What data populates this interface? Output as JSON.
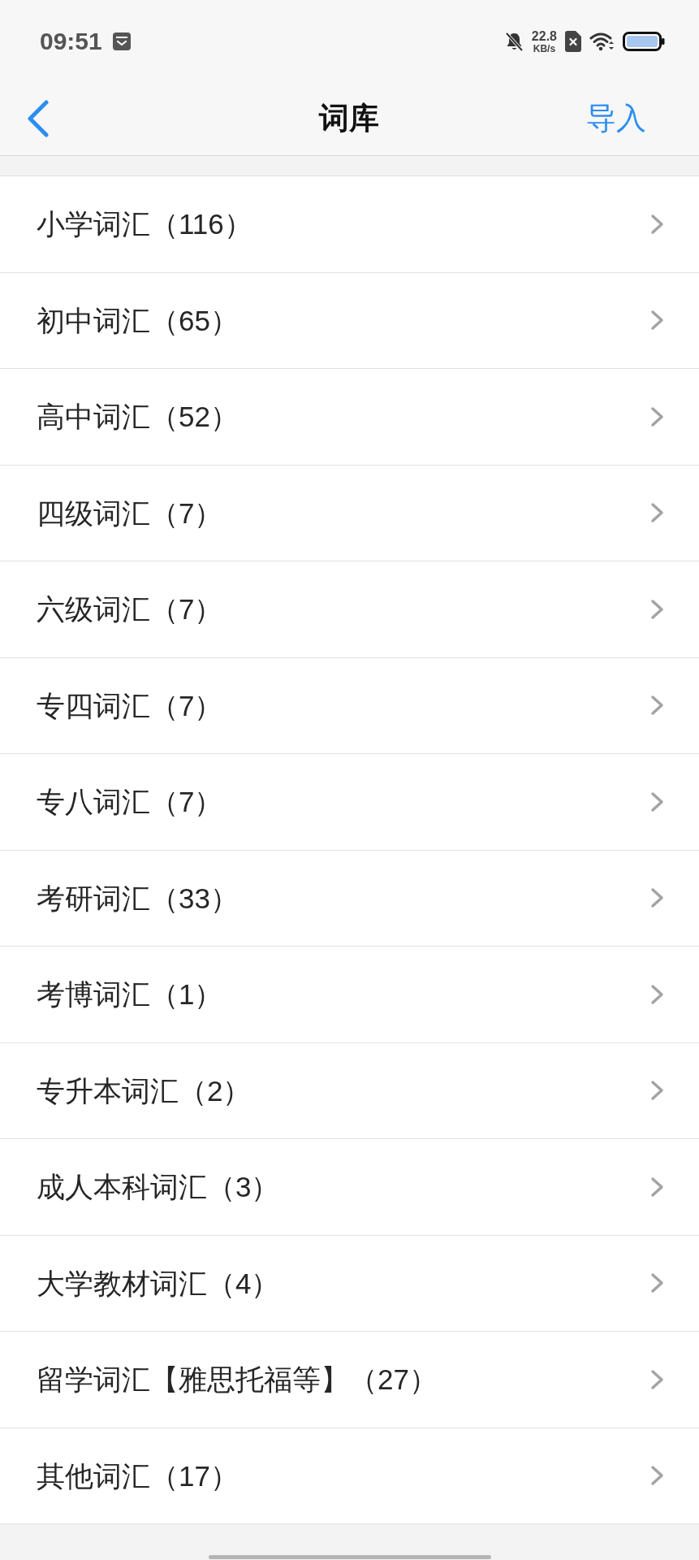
{
  "status_bar": {
    "time": "09:51",
    "network_speed": {
      "value": "22.8",
      "unit": "KB/s"
    }
  },
  "nav_bar": {
    "title": "词库",
    "action": "导入"
  },
  "list": [
    {
      "label": "小学词汇（116）"
    },
    {
      "label": "初中词汇（65）"
    },
    {
      "label": "高中词汇（52）"
    },
    {
      "label": "四级词汇（7）"
    },
    {
      "label": "六级词汇（7）"
    },
    {
      "label": "专四词汇（7）"
    },
    {
      "label": "专八词汇（7）"
    },
    {
      "label": "考研词汇（33）"
    },
    {
      "label": "考博词汇（1）"
    },
    {
      "label": "专升本词汇（2）"
    },
    {
      "label": "成人本科词汇（3）"
    },
    {
      "label": "大学教材词汇（4）"
    },
    {
      "label": "留学词汇【雅思托福等】（27）"
    },
    {
      "label": "其他词汇（17）"
    }
  ]
}
